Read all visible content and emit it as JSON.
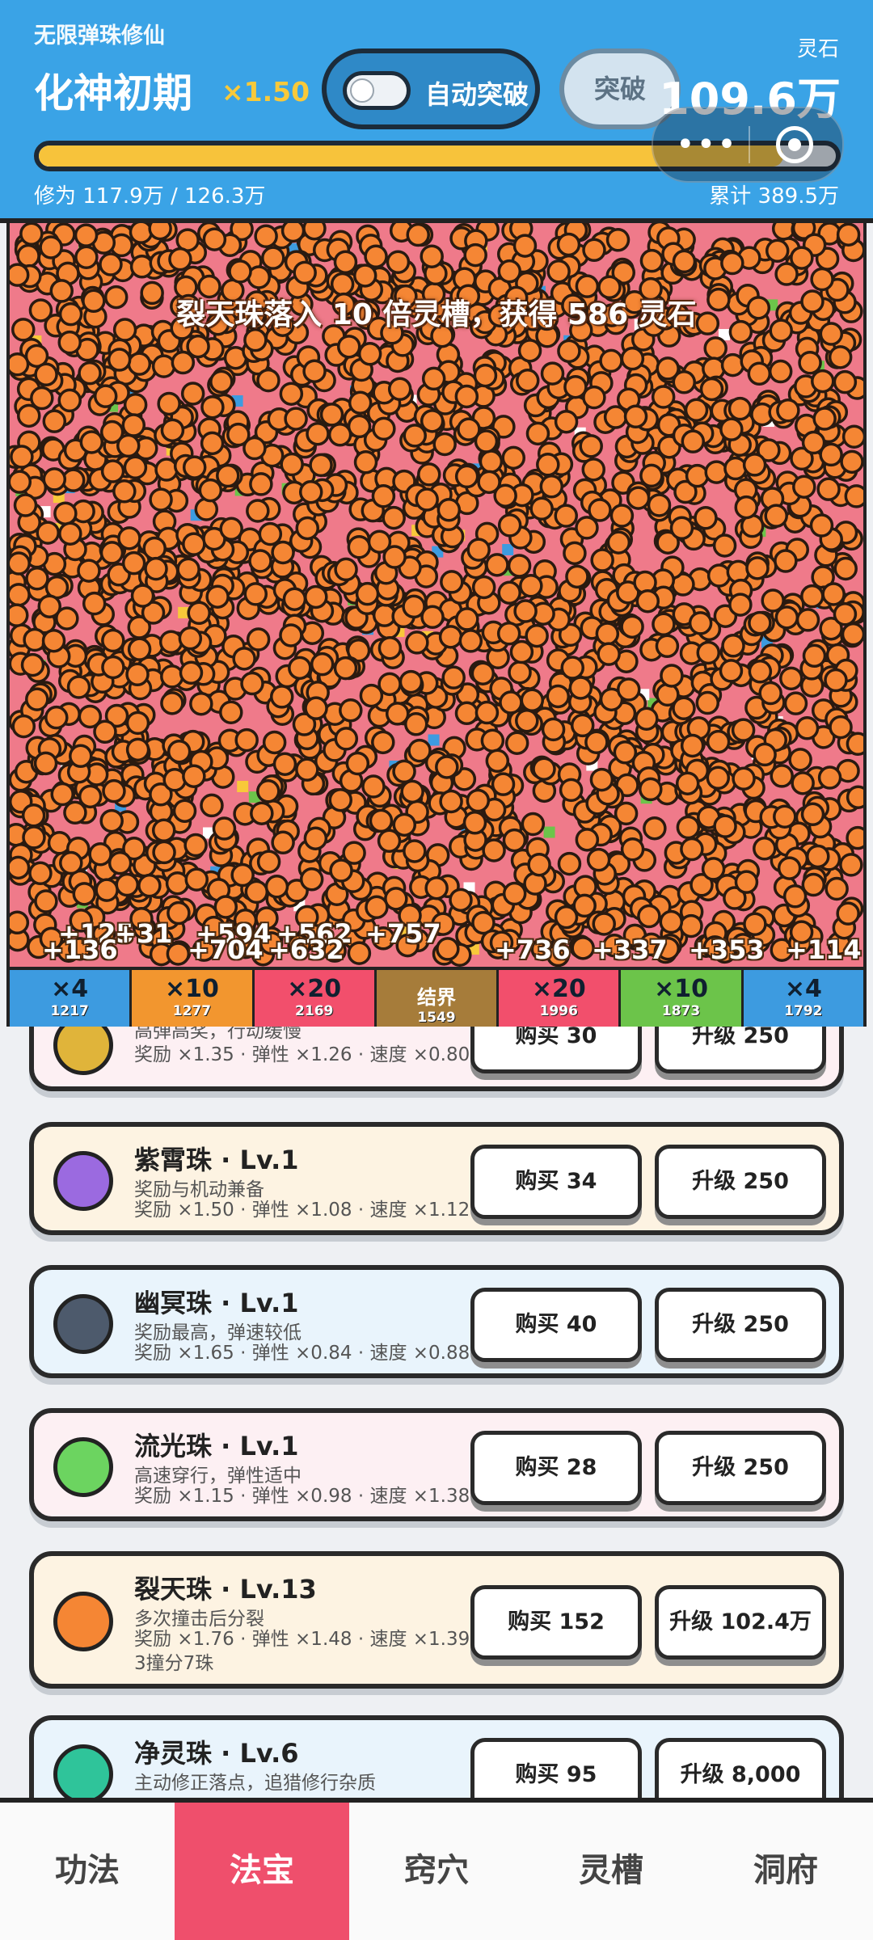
{
  "header": {
    "app_name": "无限弹珠修仙",
    "realm": "化神初期",
    "multiplier": "×1.50",
    "auto_breakthrough_label": "自动突破",
    "auto_breakthrough_on": false,
    "breakthrough_label": "突破",
    "stone_label": "灵石",
    "stone_value": "109.6万",
    "progress_fraction": 0.934,
    "cultivation_text": "修为 117.9万 / 126.3万",
    "total_text": "累计 389.5万",
    "capsule_more_icon": "more-dots-icon",
    "capsule_close_icon": "target-close-icon"
  },
  "board": {
    "event_text": "裂天珠落入 10 倍灵槽，获得 586 灵石",
    "floats": [
      "+125",
      "+31",
      "+594",
      "+562",
      "+136",
      "+704",
      "+632",
      "+757",
      "+736",
      "+337",
      "+353",
      "+114"
    ],
    "slots": [
      {
        "mult": "×4",
        "count": "1217",
        "color": "#3d9be0"
      },
      {
        "mult": "×10",
        "count": "1277",
        "color": "#f2962f"
      },
      {
        "mult": "×20",
        "count": "2169",
        "color": "#f24f6c"
      },
      {
        "mult": "结界",
        "count": "1549",
        "color": "#a67c3a"
      },
      {
        "mult": "×20",
        "count": "1996",
        "color": "#f24f6c"
      },
      {
        "mult": "×10",
        "count": "1873",
        "color": "#6cc44a"
      },
      {
        "mult": "×4",
        "count": "1792",
        "color": "#3d9be0"
      }
    ]
  },
  "beads": [
    {
      "name": "",
      "desc": "高弹高奖，行动缓慢",
      "stats": "奖励 ×1.35 · 弹性 ×1.26 · 速度 ×0.80",
      "buy": "购买 30",
      "upgrade": "升级 250",
      "ball_color": "#e0b43a",
      "bg": "#fdf0f3"
    },
    {
      "name": "紫霄珠 · Lv.1",
      "desc": "奖励与机动兼备",
      "stats": "奖励 ×1.50 · 弹性 ×1.08 · 速度 ×1.12",
      "buy": "购买 34",
      "upgrade": "升级 250",
      "ball_color": "#9b6ae0",
      "bg": "#fdf3e2"
    },
    {
      "name": "幽冥珠 · Lv.1",
      "desc": "奖励最高，弹速较低",
      "stats": "奖励 ×1.65 · 弹性 ×0.84 · 速度 ×0.88",
      "buy": "购买 40",
      "upgrade": "升级 250",
      "ball_color": "#4d5a6c",
      "bg": "#e9f4fc"
    },
    {
      "name": "流光珠 · Lv.1",
      "desc": "高速穿行，弹性适中",
      "stats": "奖励 ×1.15 · 弹性 ×0.98 · 速度 ×1.38",
      "buy": "购买 28",
      "upgrade": "升级 250",
      "ball_color": "#6cd460",
      "bg": "#fdf0f3"
    },
    {
      "name": "裂天珠 · Lv.13",
      "desc": "多次撞击后分裂",
      "stats": "奖励 ×1.76 · 弹性 ×1.48 · 速度 ×1.39 · 3撞分7珠",
      "buy": "购买 152",
      "upgrade": "升级 102.4万",
      "ball_color": "#f58634",
      "bg": "#fdf3e2"
    },
    {
      "name": "净灵珠 · Lv.6",
      "desc": "主动修正落点，追猎修行杂质",
      "stats": "",
      "buy": "购买 95",
      "upgrade": "升级 8,000",
      "ball_color": "#2fc49a",
      "bg": "#e9f4fc"
    }
  ],
  "tabs": [
    "功法",
    "法宝",
    "窍穴",
    "灵槽",
    "洞府"
  ],
  "active_tab": 1
}
